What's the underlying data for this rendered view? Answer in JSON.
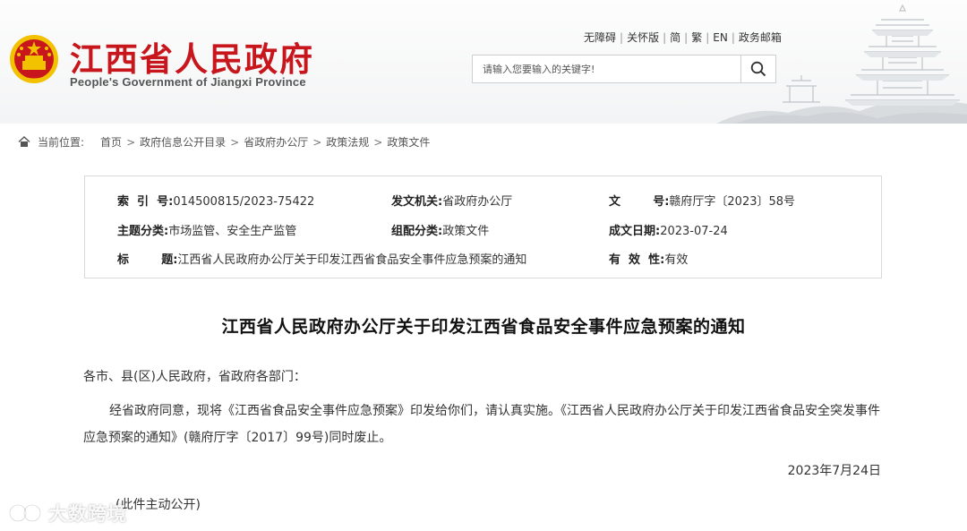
{
  "header": {
    "title": "江西省人民政府",
    "subtitle": "People's Government of Jiangxi Province",
    "links": [
      "无障碍",
      "关怀版",
      "简",
      "繁",
      "EN",
      "政务邮箱"
    ],
    "search_placeholder": "请输入您要输入的关键字!"
  },
  "breadcrumb": {
    "label": "当前位置:",
    "items": [
      "首页",
      "政府信息公开目录",
      "省政府办公厅",
      "政策法规",
      "政策文件"
    ]
  },
  "info": {
    "index_no_key": "索  引  号:",
    "index_no": "014500815/2023-75422",
    "issuer_key": "发文机关:",
    "issuer": "省政府办公厅",
    "doc_no_key": "文        号:",
    "doc_no": "赣府厅字〔2023〕58号",
    "topic_key": "主题分类:",
    "topic": "市场监管、安全生产监管",
    "group_key": "组配分类:",
    "group": "政策文件",
    "date_key": "成文日期:",
    "date": "2023-07-24",
    "title_key": "标        题:",
    "title": "江西省人民政府办公厅关于印发江西省食品安全事件应急预案的通知",
    "validity_key": "有  效  性:",
    "validity": "有效"
  },
  "article": {
    "title": "江西省人民政府办公厅关于印发江西省食品安全事件应急预案的通知",
    "salutation": "各市、县(区)人民政府，省政府各部门：",
    "body": "经省政府同意，现将《江西省食品安全事件应急预案》印发给你们，请认真实施。《江西省人民政府办公厅关于印发江西省食品安全突发事件应急预案的通知》(赣府厅字〔2017〕99号)同时废止。",
    "date": "2023年7月24日",
    "note": "(此件主动公开)"
  },
  "watermark": "大数跨境",
  "colors": {
    "brand_red": "#c8161d",
    "gold": "#f2c200"
  }
}
